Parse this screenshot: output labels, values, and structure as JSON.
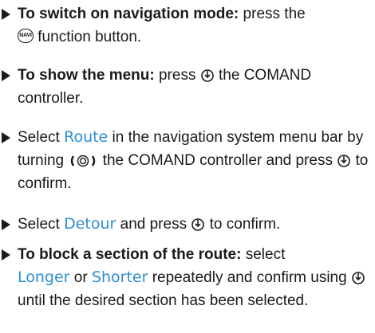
{
  "steps": [
    {
      "bold": "To switch on navigation mode:",
      "t1": " press the",
      "icon_navi": "NAVI",
      "t2": " function button."
    },
    {
      "bold": "To show the menu:",
      "t1": " press",
      "t2": " the COMAND controller."
    },
    {
      "t0": "Select ",
      "ui": "Route",
      "t1": " in the navigation system menu bar by turning",
      "t2": " the COMAND controller and press",
      "t3": " to confirm."
    },
    {
      "t0": "Select ",
      "ui": "Detour",
      "t1": " and press",
      "t2": " to confirm."
    },
    {
      "bold": "To block a section of the route:",
      "t1": " select",
      "ui1": "Longer",
      "t2": " or ",
      "ui2": "Shorter",
      "t3": " repeatedly and confirm using",
      "t4": " until the desired section has been selected."
    }
  ],
  "icons": {
    "press": "controller-press-icon",
    "turn": "controller-turn-icon",
    "navi": "navi-button-icon"
  }
}
